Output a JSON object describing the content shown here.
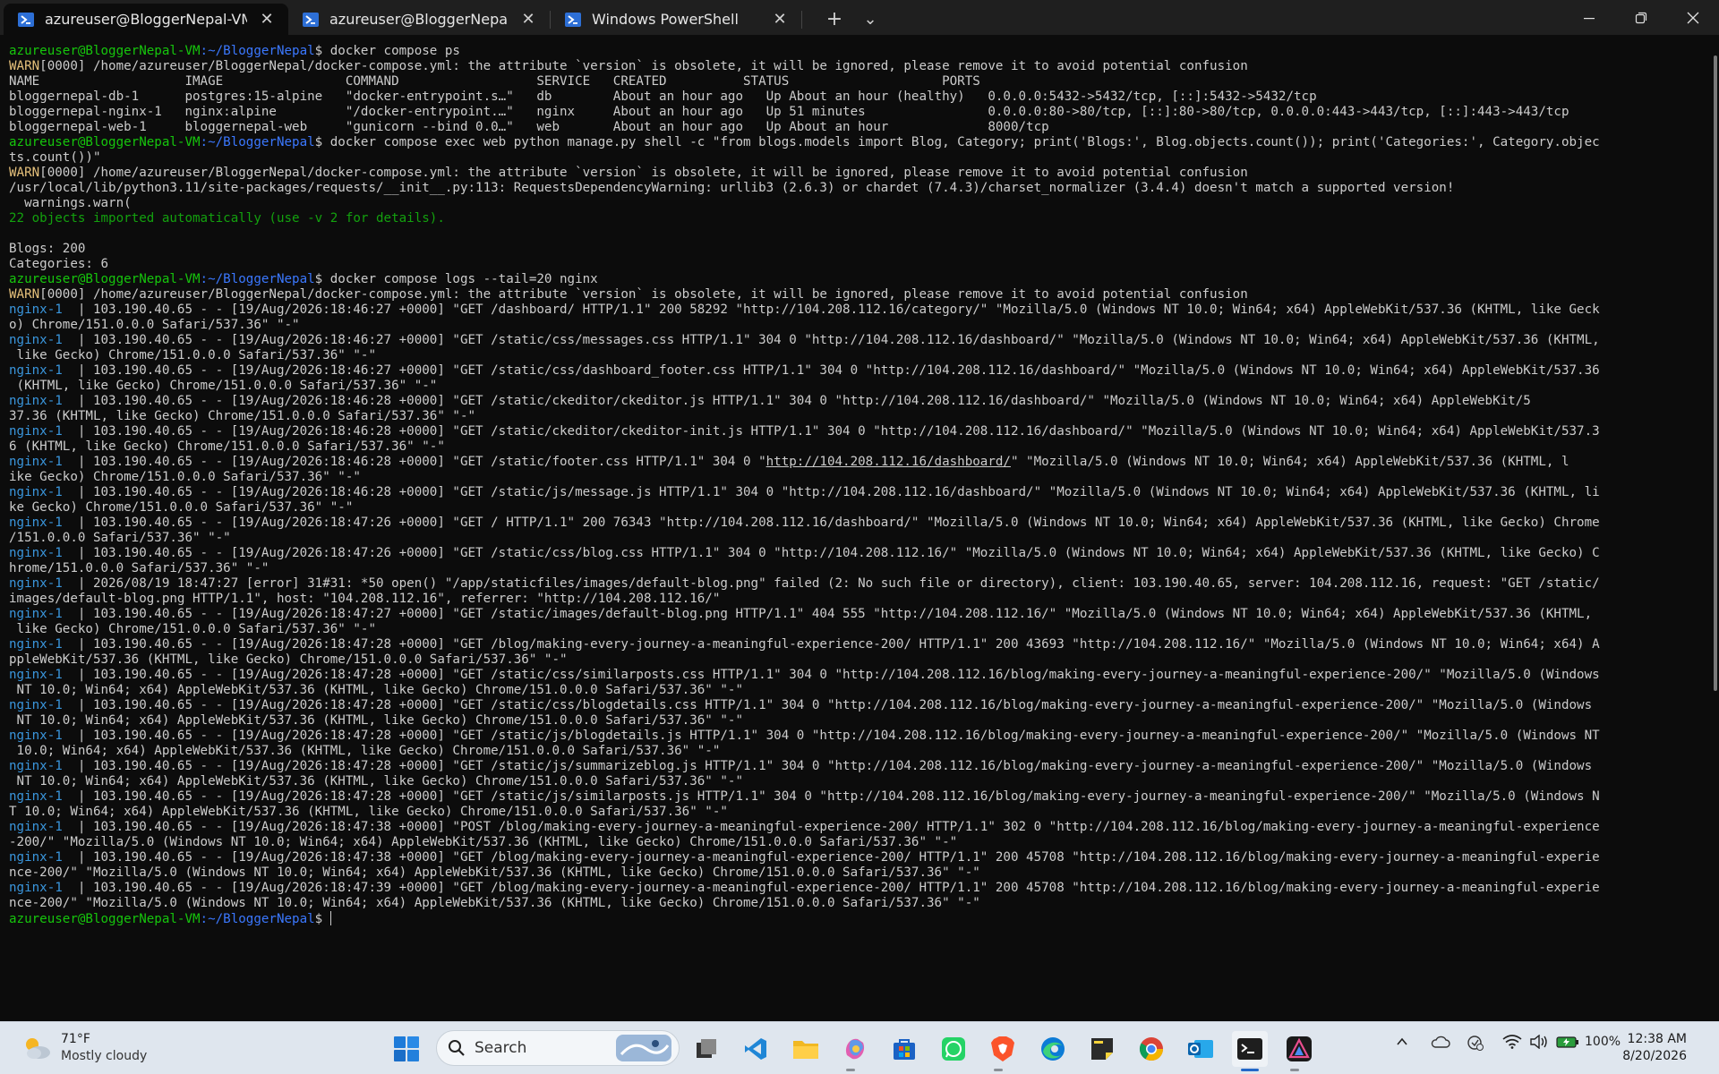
{
  "tabs": [
    {
      "label": "azureuser@BloggerNepal-VM",
      "active": true
    },
    {
      "label": "azureuser@BloggerNepal-VM:",
      "active": false
    },
    {
      "label": "Windows PowerShell",
      "active": false
    }
  ],
  "tabbar": {
    "new_tab": "+",
    "dropdown": "⌄"
  },
  "prompt": {
    "user": "azureuser@BloggerNepal-VM",
    "path": ":~/BloggerNepal",
    "sym": "$ "
  },
  "lines": [
    [
      [
        "g",
        "azureuser@BloggerNepal-VM"
      ],
      [
        "b",
        ":~/BloggerNepal"
      ],
      [
        "w",
        "$ docker compose ps"
      ]
    ],
    [
      [
        "y",
        "WARN"
      ],
      [
        "w",
        "[0000] /home/azureuser/BloggerNepal/docker-compose.yml: the attribute `version` is obsolete, it will be ignored, please remove it to avoid potential confusion"
      ]
    ],
    [
      [
        "w",
        "NAME                   IMAGE                COMMAND                  SERVICE   CREATED          STATUS                    PORTS"
      ]
    ],
    [
      [
        "w",
        "bloggernepal-db-1      postgres:15-alpine   \"docker-entrypoint.s…\"   db        About an hour ago   Up About an hour (healthy)   0.0.0.0:5432->5432/tcp, [::]:5432->5432/tcp"
      ]
    ],
    [
      [
        "w",
        "bloggernepal-nginx-1   nginx:alpine         \"/docker-entrypoint.…\"   nginx     About an hour ago   Up 51 minutes                0.0.0.0:80->80/tcp, [::]:80->80/tcp, 0.0.0.0:443->443/tcp, [::]:443->443/tcp"
      ]
    ],
    [
      [
        "w",
        "bloggernepal-web-1     bloggernepal-web     \"gunicorn --bind 0.0…\"   web       About an hour ago   Up About an hour             8000/tcp"
      ]
    ],
    [
      [
        "g",
        "azureuser@BloggerNepal-VM"
      ],
      [
        "b",
        ":~/BloggerNepal"
      ],
      [
        "w",
        "$ docker compose exec web python manage.py shell -c \"from blogs.models import Blog, Category; print('Blogs:', Blog.objects.count()); print('Categories:', Category.objec"
      ]
    ],
    [
      [
        "w",
        "ts.count())\""
      ]
    ],
    [
      [
        "y",
        "WARN"
      ],
      [
        "w",
        "[0000] /home/azureuser/BloggerNepal/docker-compose.yml: the attribute `version` is obsolete, it will be ignored, please remove it to avoid potential confusion"
      ]
    ],
    [
      [
        "w",
        "/usr/local/lib/python3.11/site-packages/requests/__init__.py:113: RequestsDependencyWarning: urllib3 (2.6.3) or chardet (7.4.3)/charset_normalizer (3.4.4) doesn't match a supported version!"
      ]
    ],
    [
      [
        "w",
        "  warnings.warn("
      ]
    ],
    [
      [
        "gm",
        "22 objects imported automatically (use -v 2 for details)."
      ]
    ],
    [
      [
        "w",
        ""
      ]
    ],
    [
      [
        "w",
        "Blogs: 200"
      ]
    ],
    [
      [
        "w",
        "Categories: 6"
      ]
    ],
    [
      [
        "g",
        "azureuser@BloggerNepal-VM"
      ],
      [
        "b",
        ":~/BloggerNepal"
      ],
      [
        "w",
        "$ docker compose logs --tail=20 nginx"
      ]
    ],
    [
      [
        "y",
        "WARN"
      ],
      [
        "w",
        "[0000] /home/azureuser/BloggerNepal/docker-compose.yml: the attribute `version` is obsolete, it will be ignored, please remove it to avoid potential confusion"
      ]
    ],
    [
      [
        "c",
        "nginx-1"
      ],
      [
        "w",
        "  | 103.190.40.65 - - [19/Aug/2026:18:46:27 +0000] \"GET /dashboard/ HTTP/1.1\" 200 58292 \"http://104.208.112.16/category/\" \"Mozilla/5.0 (Windows NT 10.0; Win64; x64) AppleWebKit/537.36 (KHTML, like Geck"
      ]
    ],
    [
      [
        "w",
        "o) Chrome/151.0.0.0 Safari/537.36\" \"-\""
      ]
    ],
    [
      [
        "c",
        "nginx-1"
      ],
      [
        "w",
        "  | 103.190.40.65 - - [19/Aug/2026:18:46:27 +0000] \"GET /static/css/messages.css HTTP/1.1\" 304 0 \"http://104.208.112.16/dashboard/\" \"Mozilla/5.0 (Windows NT 10.0; Win64; x64) AppleWebKit/537.36 (KHTML,"
      ]
    ],
    [
      [
        "w",
        " like Gecko) Chrome/151.0.0.0 Safari/537.36\" \"-\""
      ]
    ],
    [
      [
        "c",
        "nginx-1"
      ],
      [
        "w",
        "  | 103.190.40.65 - - [19/Aug/2026:18:46:27 +0000] \"GET /static/css/dashboard_footer.css HTTP/1.1\" 304 0 \"http://104.208.112.16/dashboard/\" \"Mozilla/5.0 (Windows NT 10.0; Win64; x64) AppleWebKit/537.36"
      ]
    ],
    [
      [
        "w",
        " (KHTML, like Gecko) Chrome/151.0.0.0 Safari/537.36\" \"-\""
      ]
    ],
    [
      [
        "c",
        "nginx-1"
      ],
      [
        "w",
        "  | 103.190.40.65 - - [19/Aug/2026:18:46:28 +0000] \"GET /static/ckeditor/ckeditor.js HTTP/1.1\" 304 0 \"http://104.208.112.16/dashboard/\" \"Mozilla/5.0 (Windows NT 10.0; Win64; x64) AppleWebKit/5"
      ]
    ],
    [
      [
        "w",
        "37.36 (KHTML, like Gecko) Chrome/151.0.0.0 Safari/537.36\" \"-\""
      ]
    ],
    [
      [
        "c",
        "nginx-1"
      ],
      [
        "w",
        "  | 103.190.40.65 - - [19/Aug/2026:18:46:28 +0000] \"GET /static/ckeditor/ckeditor-init.js HTTP/1.1\" 304 0 \"http://104.208.112.16/dashboard/\" \"Mozilla/5.0 (Windows NT 10.0; Win64; x64) AppleWebKit/537.3"
      ]
    ],
    [
      [
        "w",
        "6 (KHTML, like Gecko) Chrome/151.0.0.0 Safari/537.36\" \"-\""
      ]
    ],
    [
      [
        "c",
        "nginx-1"
      ],
      [
        "w",
        "  | 103.190.40.65 - - [19/Aug/2026:18:46:28 +0000] \"GET /static/footer.css HTTP/1.1\" 304 0 \""
      ],
      [
        "u",
        "http://104.208.112.16/dashboard/"
      ],
      [
        "w",
        "\" \"Mozilla/5.0 (Windows NT 10.0; Win64; x64) AppleWebKit/537.36 (KHTML, l"
      ]
    ],
    [
      [
        "w",
        "ike Gecko) Chrome/151.0.0.0 Safari/537.36\" \"-\""
      ]
    ],
    [
      [
        "c",
        "nginx-1"
      ],
      [
        "w",
        "  | 103.190.40.65 - - [19/Aug/2026:18:46:28 +0000] \"GET /static/js/message.js HTTP/1.1\" 304 0 \"http://104.208.112.16/dashboard/\" \"Mozilla/5.0 (Windows NT 10.0; Win64; x64) AppleWebKit/537.36 (KHTML, li"
      ]
    ],
    [
      [
        "w",
        "ke Gecko) Chrome/151.0.0.0 Safari/537.36\" \"-\""
      ]
    ],
    [
      [
        "c",
        "nginx-1"
      ],
      [
        "w",
        "  | 103.190.40.65 - - [19/Aug/2026:18:47:26 +0000] \"GET / HTTP/1.1\" 200 76343 \"http://104.208.112.16/dashboard/\" \"Mozilla/5.0 (Windows NT 10.0; Win64; x64) AppleWebKit/537.36 (KHTML, like Gecko) Chrome"
      ]
    ],
    [
      [
        "w",
        "/151.0.0.0 Safari/537.36\" \"-\""
      ]
    ],
    [
      [
        "c",
        "nginx-1"
      ],
      [
        "w",
        "  | 103.190.40.65 - - [19/Aug/2026:18:47:26 +0000] \"GET /static/css/blog.css HTTP/1.1\" 304 0 \"http://104.208.112.16/\" \"Mozilla/5.0 (Windows NT 10.0; Win64; x64) AppleWebKit/537.36 (KHTML, like Gecko) C"
      ]
    ],
    [
      [
        "w",
        "hrome/151.0.0.0 Safari/537.36\" \"-\""
      ]
    ],
    [
      [
        "c",
        "nginx-1"
      ],
      [
        "w",
        "  | 2026/08/19 18:47:27 [error] 31#31: *50 open() \"/app/staticfiles/images/default-blog.png\" failed (2: No such file or directory), client: 103.190.40.65, server: 104.208.112.16, request: \"GET /static/"
      ]
    ],
    [
      [
        "w",
        "images/default-blog.png HTTP/1.1\", host: \"104.208.112.16\", referrer: \"http://104.208.112.16/\""
      ]
    ],
    [
      [
        "c",
        "nginx-1"
      ],
      [
        "w",
        "  | 103.190.40.65 - - [19/Aug/2026:18:47:27 +0000] \"GET /static/images/default-blog.png HTTP/1.1\" 404 555 \"http://104.208.112.16/\" \"Mozilla/5.0 (Windows NT 10.0; Win64; x64) AppleWebKit/537.36 (KHTML,"
      ]
    ],
    [
      [
        "w",
        " like Gecko) Chrome/151.0.0.0 Safari/537.36\" \"-\""
      ]
    ],
    [
      [
        "c",
        "nginx-1"
      ],
      [
        "w",
        "  | 103.190.40.65 - - [19/Aug/2026:18:47:28 +0000] \"GET /blog/making-every-journey-a-meaningful-experience-200/ HTTP/1.1\" 200 43693 \"http://104.208.112.16/\" \"Mozilla/5.0 (Windows NT 10.0; Win64; x64) A"
      ]
    ],
    [
      [
        "w",
        "ppleWebKit/537.36 (KHTML, like Gecko) Chrome/151.0.0.0 Safari/537.36\" \"-\""
      ]
    ],
    [
      [
        "c",
        "nginx-1"
      ],
      [
        "w",
        "  | 103.190.40.65 - - [19/Aug/2026:18:47:28 +0000] \"GET /static/css/similarposts.css HTTP/1.1\" 304 0 \"http://104.208.112.16/blog/making-every-journey-a-meaningful-experience-200/\" \"Mozilla/5.0 (Windows"
      ]
    ],
    [
      [
        "w",
        " NT 10.0; Win64; x64) AppleWebKit/537.36 (KHTML, like Gecko) Chrome/151.0.0.0 Safari/537.36\" \"-\""
      ]
    ],
    [
      [
        "c",
        "nginx-1"
      ],
      [
        "w",
        "  | 103.190.40.65 - - [19/Aug/2026:18:47:28 +0000] \"GET /static/css/blogdetails.css HTTP/1.1\" 304 0 \"http://104.208.112.16/blog/making-every-journey-a-meaningful-experience-200/\" \"Mozilla/5.0 (Windows"
      ]
    ],
    [
      [
        "w",
        " NT 10.0; Win64; x64) AppleWebKit/537.36 (KHTML, like Gecko) Chrome/151.0.0.0 Safari/537.36\" \"-\""
      ]
    ],
    [
      [
        "c",
        "nginx-1"
      ],
      [
        "w",
        "  | 103.190.40.65 - - [19/Aug/2026:18:47:28 +0000] \"GET /static/js/blogdetails.js HTTP/1.1\" 304 0 \"http://104.208.112.16/blog/making-every-journey-a-meaningful-experience-200/\" \"Mozilla/5.0 (Windows NT"
      ]
    ],
    [
      [
        "w",
        " 10.0; Win64; x64) AppleWebKit/537.36 (KHTML, like Gecko) Chrome/151.0.0.0 Safari/537.36\" \"-\""
      ]
    ],
    [
      [
        "c",
        "nginx-1"
      ],
      [
        "w",
        "  | 103.190.40.65 - - [19/Aug/2026:18:47:28 +0000] \"GET /static/js/summarizeblog.js HTTP/1.1\" 304 0 \"http://104.208.112.16/blog/making-every-journey-a-meaningful-experience-200/\" \"Mozilla/5.0 (Windows"
      ]
    ],
    [
      [
        "w",
        " NT 10.0; Win64; x64) AppleWebKit/537.36 (KHTML, like Gecko) Chrome/151.0.0.0 Safari/537.36\" \"-\""
      ]
    ],
    [
      [
        "c",
        "nginx-1"
      ],
      [
        "w",
        "  | 103.190.40.65 - - [19/Aug/2026:18:47:28 +0000] \"GET /static/js/similarposts.js HTTP/1.1\" 304 0 \"http://104.208.112.16/blog/making-every-journey-a-meaningful-experience-200/\" \"Mozilla/5.0 (Windows N"
      ]
    ],
    [
      [
        "w",
        "T 10.0; Win64; x64) AppleWebKit/537.36 (KHTML, like Gecko) Chrome/151.0.0.0 Safari/537.36\" \"-\""
      ]
    ],
    [
      [
        "c",
        "nginx-1"
      ],
      [
        "w",
        "  | 103.190.40.65 - - [19/Aug/2026:18:47:38 +0000] \"POST /blog/making-every-journey-a-meaningful-experience-200/ HTTP/1.1\" 302 0 \"http://104.208.112.16/blog/making-every-journey-a-meaningful-experience"
      ]
    ],
    [
      [
        "w",
        "-200/\" \"Mozilla/5.0 (Windows NT 10.0; Win64; x64) AppleWebKit/537.36 (KHTML, like Gecko) Chrome/151.0.0.0 Safari/537.36\" \"-\""
      ]
    ],
    [
      [
        "c",
        "nginx-1"
      ],
      [
        "w",
        "  | 103.190.40.65 - - [19/Aug/2026:18:47:38 +0000] \"GET /blog/making-every-journey-a-meaningful-experience-200/ HTTP/1.1\" 200 45708 \"http://104.208.112.16/blog/making-every-journey-a-meaningful-experie"
      ]
    ],
    [
      [
        "w",
        "nce-200/\" \"Mozilla/5.0 (Windows NT 10.0; Win64; x64) AppleWebKit/537.36 (KHTML, like Gecko) Chrome/151.0.0.0 Safari/537.36\" \"-\""
      ]
    ],
    [
      [
        "c",
        "nginx-1"
      ],
      [
        "w",
        "  | 103.190.40.65 - - [19/Aug/2026:18:47:39 +0000] \"GET /blog/making-every-journey-a-meaningful-experience-200/ HTTP/1.1\" 200 45708 \"http://104.208.112.16/blog/making-every-journey-a-meaningful-experie"
      ]
    ],
    [
      [
        "w",
        "nce-200/\" \"Mozilla/5.0 (Windows NT 10.0; Win64; x64) AppleWebKit/537.36 (KHTML, like Gecko) Chrome/151.0.0.0 Safari/537.36\" \"-\""
      ]
    ],
    [
      [
        "g",
        "azureuser@BloggerNepal-VM"
      ],
      [
        "b",
        ":~/BloggerNepal"
      ],
      [
        "w",
        "$ "
      ]
    ]
  ],
  "taskbar": {
    "weather": {
      "temp": "71°F",
      "condition": "Mostly cloudy"
    },
    "search_placeholder": "Search",
    "battery": "100%",
    "time": "12:38 AM",
    "date": "8/20/2026",
    "icons": [
      "start-icon",
      "search-icon",
      "task-view-icon",
      "vscode-icon",
      "file-explorer-icon",
      "copilot-icon",
      "store-icon",
      "whatsapp-icon",
      "brave-icon",
      "edge-icon",
      "sticky-notes-icon",
      "chrome-icon",
      "outlook-icon",
      "terminal-icon",
      "affinity-icon"
    ]
  },
  "colors": {
    "green": "#16c60c",
    "blue": "#3b78ff",
    "yellow": "#e5c07b",
    "cyan": "#3a96dd",
    "bg": "#0c0c0c"
  }
}
